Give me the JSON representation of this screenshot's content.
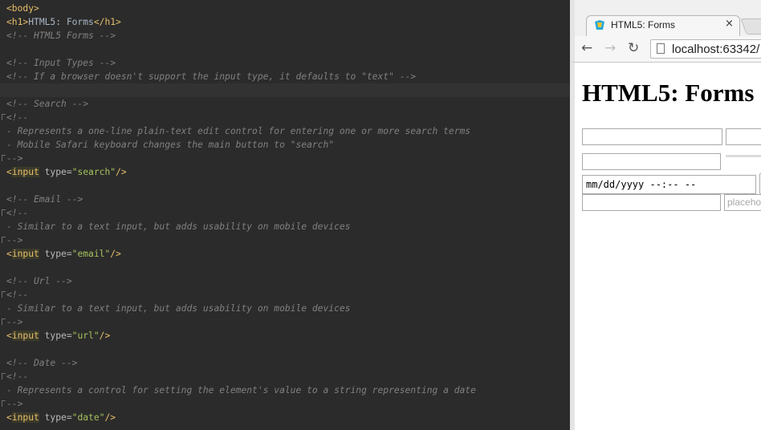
{
  "editor": {
    "lines": [
      {
        "segments": [
          {
            "t": "<body>",
            "c": "tag"
          }
        ]
      },
      {
        "segments": [
          {
            "t": "<h1>",
            "c": "tag"
          },
          {
            "t": "HTML5: Forms",
            "c": "plain"
          },
          {
            "t": "</h1>",
            "c": "tag"
          }
        ]
      },
      {
        "segments": [
          {
            "t": "<!-- HTML5 Forms -->",
            "c": "c"
          }
        ]
      },
      {
        "segments": []
      },
      {
        "segments": [
          {
            "t": "<!-- Input Types -->",
            "c": "c"
          }
        ]
      },
      {
        "segments": [
          {
            "t": "<!-- If a browser doesn't support the input type, it defaults to \"text\" -->",
            "c": "c"
          }
        ]
      },
      {
        "segments": [],
        "current": true
      },
      {
        "segments": [
          {
            "t": "<!-- Search -->",
            "c": "c"
          }
        ]
      },
      {
        "segments": [
          {
            "t": "<!--",
            "c": "c"
          }
        ],
        "fold": true
      },
      {
        "segments": [
          {
            "t": "- Represents a one-line plain-text edit control for entering one or more search terms",
            "c": "c"
          }
        ]
      },
      {
        "segments": [
          {
            "t": "- Mobile Safari keyboard changes the main button to \"search\"",
            "c": "c"
          }
        ]
      },
      {
        "segments": [
          {
            "t": "-->",
            "c": "c"
          }
        ],
        "fold": true
      },
      {
        "segments": [
          {
            "t": "<",
            "c": "tag"
          },
          {
            "t": "input",
            "c": "tagHL"
          },
          {
            "t": " type=",
            "c": "attr"
          },
          {
            "t": "\"search\"",
            "c": "str"
          },
          {
            "t": "/>",
            "c": "tag"
          }
        ]
      },
      {
        "segments": []
      },
      {
        "segments": [
          {
            "t": "<!-- Email -->",
            "c": "c"
          }
        ]
      },
      {
        "segments": [
          {
            "t": "<!--",
            "c": "c"
          }
        ],
        "fold": true
      },
      {
        "segments": [
          {
            "t": "- Similar to a text input, but adds usability on mobile devices",
            "c": "c"
          }
        ]
      },
      {
        "segments": [
          {
            "t": "-->",
            "c": "c"
          }
        ],
        "fold": true
      },
      {
        "segments": [
          {
            "t": "<",
            "c": "tag"
          },
          {
            "t": "input",
            "c": "tagHL"
          },
          {
            "t": " type=",
            "c": "attr"
          },
          {
            "t": "\"email\"",
            "c": "str"
          },
          {
            "t": "/>",
            "c": "tag"
          }
        ]
      },
      {
        "segments": []
      },
      {
        "segments": [
          {
            "t": "<!-- Url -->",
            "c": "c"
          }
        ]
      },
      {
        "segments": [
          {
            "t": "<!--",
            "c": "c"
          }
        ],
        "fold": true
      },
      {
        "segments": [
          {
            "t": "- Similar to a text input, but adds usability on mobile devices",
            "c": "c"
          }
        ]
      },
      {
        "segments": [
          {
            "t": "-->",
            "c": "c"
          }
        ],
        "fold": true
      },
      {
        "segments": [
          {
            "t": "<",
            "c": "tag"
          },
          {
            "t": "input",
            "c": "tagHL"
          },
          {
            "t": " type=",
            "c": "attr"
          },
          {
            "t": "\"url\"",
            "c": "str"
          },
          {
            "t": "/>",
            "c": "tag"
          }
        ]
      },
      {
        "segments": []
      },
      {
        "segments": [
          {
            "t": "<!-- Date -->",
            "c": "c"
          }
        ]
      },
      {
        "segments": [
          {
            "t": "<!--",
            "c": "c"
          }
        ],
        "fold": true
      },
      {
        "segments": [
          {
            "t": "- Represents a control for setting the element's value to a string representing a date",
            "c": "c"
          }
        ]
      },
      {
        "segments": [
          {
            "t": "-->",
            "c": "c"
          }
        ],
        "fold": true
      },
      {
        "segments": [
          {
            "t": "<",
            "c": "tag"
          },
          {
            "t": "input",
            "c": "tagHL"
          },
          {
            "t": " type=",
            "c": "attr"
          },
          {
            "t": "\"date\"",
            "c": "str"
          },
          {
            "t": "/>",
            "c": "tag"
          }
        ]
      }
    ]
  },
  "browser": {
    "tab_title": "HTML5: Forms",
    "tab_close": "×",
    "url": "localhost:63342/",
    "page": {
      "heading": "HTML5: Forms",
      "date_value": "mm/dd/yyyy --:-- --",
      "placeholder_text": "placeholder"
    },
    "icons": {
      "back": "back-arrow",
      "forward": "forward-arrow",
      "reload": "reload",
      "page": "page"
    }
  }
}
